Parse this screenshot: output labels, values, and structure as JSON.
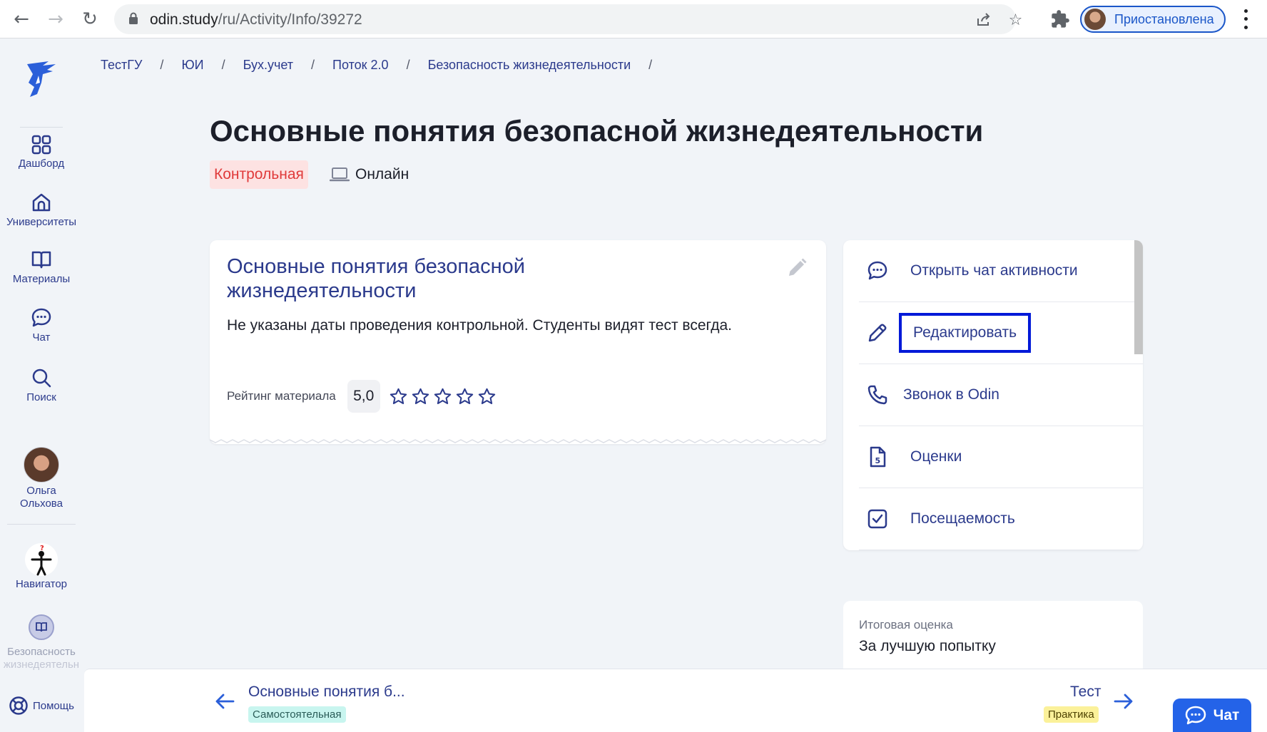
{
  "browser": {
    "url_host": "odin.study",
    "url_path": "/ru/Activity/Info/39272",
    "profile_label": "Приостановлена"
  },
  "sidebar": {
    "items": [
      {
        "label": "Дашборд",
        "icon": "grid-icon"
      },
      {
        "label": "Университеты",
        "icon": "university-icon"
      },
      {
        "label": "Материалы",
        "icon": "book-icon"
      },
      {
        "label": "Чат",
        "icon": "chat-icon"
      },
      {
        "label": "Поиск",
        "icon": "search-icon"
      }
    ],
    "user": {
      "first_name": "Ольга",
      "last_name": "Ольхова"
    },
    "navigator_label": "Навигатор",
    "course_label_1": "Безопасность",
    "course_label_2": "жизнедеятельн",
    "help_label": "Помощь"
  },
  "breadcrumbs": [
    "ТестГУ",
    "ЮИ",
    "Бух.учет",
    "Поток 2.0",
    "Безопасность жизнедеятельности"
  ],
  "breadcrumb_separator": "/",
  "page": {
    "title": "Основные понятия безопасной жизнедеятельности",
    "type_tag": "Контрольная",
    "format_tag": "Онлайн"
  },
  "card": {
    "title": "Основные понятия безопасной жизнедеятельности",
    "description": "Не указаны даты проведения контрольной. Студенты видят тест всегда.",
    "rating_label": "Рейтинг материала",
    "rating_value": "5,0",
    "stars_filled": 0,
    "stars_total": 5
  },
  "actions": [
    {
      "label": "Открыть чат активности",
      "icon": "chat-bubble-icon"
    },
    {
      "label": "Редактировать",
      "icon": "pencil-icon"
    },
    {
      "label": "Звонок в Odin",
      "icon": "phone-icon"
    },
    {
      "label": "Оценки",
      "icon": "grade-document-icon"
    },
    {
      "label": "Посещаемость",
      "icon": "checkbox-icon"
    }
  ],
  "grade": {
    "label": "Итоговая оценка",
    "value": "За лучшую попытку"
  },
  "bottom_nav": {
    "prev_title": "Основные понятия б...",
    "prev_badge": "Самостоятельная",
    "next_title": "Тест",
    "next_badge": "Практика"
  },
  "chat_button_label": "Чат",
  "colors": {
    "brand": "#2b3a8c",
    "accent": "#2463e8",
    "danger_tag_bg": "#fde2e2",
    "danger_tag_text": "#e03a3a",
    "highlight_border": "#0019d8"
  }
}
